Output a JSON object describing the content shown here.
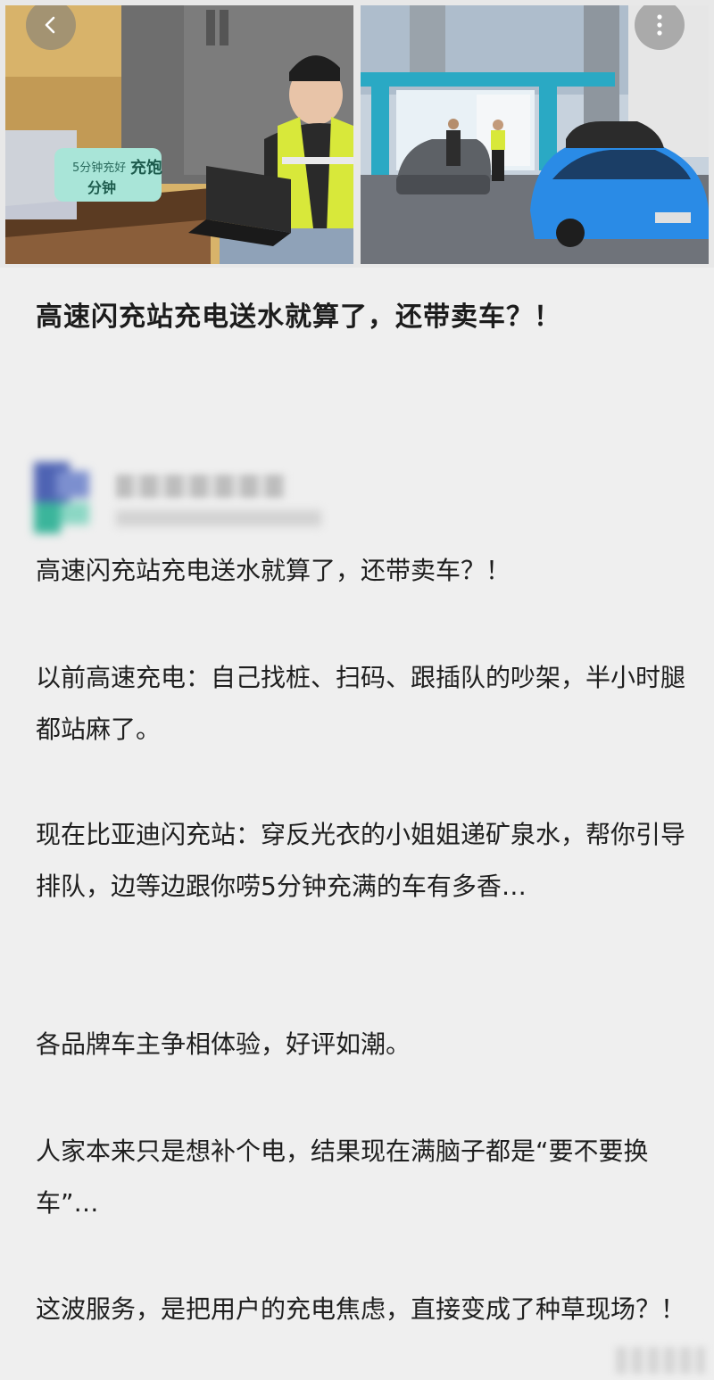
{
  "post": {
    "headline": "高速闪充站充电送水就算了，还带卖车？！",
    "paragraphs": [
      "高速闪充站充电送水就算了，还带卖车？！",
      "以前高速充电：自己找桩、扫码、跟插队的吵架，半小时腿都站麻了。",
      "现在比亚迪闪充站：穿反光衣的小姐姐递矿泉水，帮你引导排队，边等边跟你唠5分钟充满的车有多香…",
      "各品牌车主争相体验，好评如潮。",
      "人家本来只是想补个电，结果现在满脑子都是“要不要换车”…",
      "这波服务，是把用户的充电焦虑，直接变成了种草现场？！"
    ]
  },
  "photos": {
    "left_sign_top": "5分钟充好",
    "left_sign_main": "分钟",
    "left_sign_side": "充饱"
  },
  "icons": {
    "back": "chevron-left-icon",
    "more": "more-vertical-icon"
  },
  "colors": {
    "page_background": "#efefef",
    "vest_yellow": "#d8e83a",
    "car_blue": "#2a8be6",
    "canopy_teal": "#2aa9c4"
  }
}
